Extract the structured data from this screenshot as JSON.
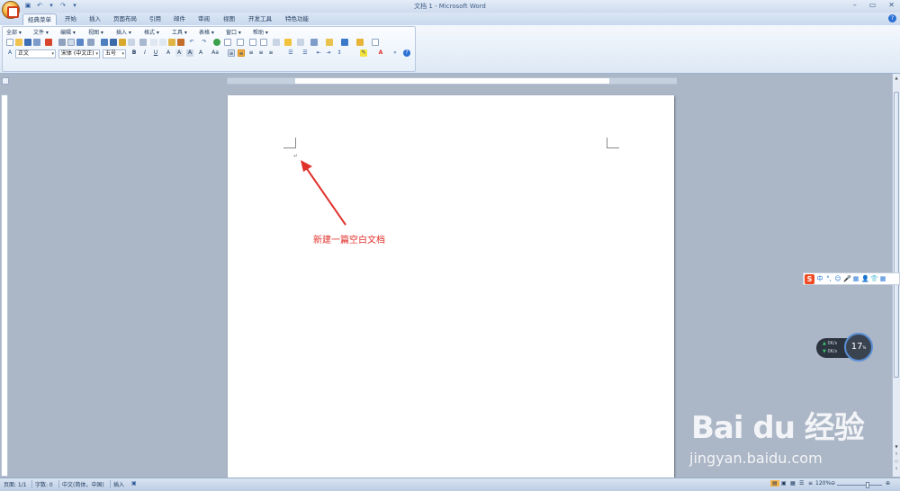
{
  "window": {
    "title": "文档 1 - Microsoft Word",
    "controls": [
      "–",
      "▭",
      "✕"
    ]
  },
  "tabs": [
    "经典菜单",
    "开始",
    "插入",
    "页面布局",
    "引用",
    "邮件",
    "审阅",
    "视图",
    "开发工具",
    "特色功能"
  ],
  "menu": [
    "全部 ▾",
    "文件 ▾",
    "编辑 ▾",
    "视图 ▾",
    "插入 ▾",
    "格式 ▾",
    "工具 ▾",
    "表格 ▾",
    "窗口 ▾",
    "帮助 ▾"
  ],
  "format_bar": {
    "style": "正文",
    "font": "宋体 (中文正)",
    "size": "五号"
  },
  "document": {
    "annotation": "新建一篇空白文档"
  },
  "ime": {
    "items": [
      "中",
      "°,",
      "☺",
      "🎤",
      "▦",
      "👤",
      "👕",
      "▦"
    ]
  },
  "net_widget": {
    "up": "0K/s",
    "down": "0K/s",
    "gauge": "17",
    "gauge_unit": "%"
  },
  "watermark": {
    "logo": "Bai du 经验",
    "url": "jingyan.baidu.com"
  },
  "status": {
    "page": "页面: 1/1",
    "words": "字数: 0",
    "lang": "中文(简体，中国)",
    "mode": "插入",
    "zoom": "120%"
  },
  "colors": {
    "annotation": "#e0312c",
    "ribbon": "#dde8f5",
    "workspace": "#abb6c6"
  }
}
